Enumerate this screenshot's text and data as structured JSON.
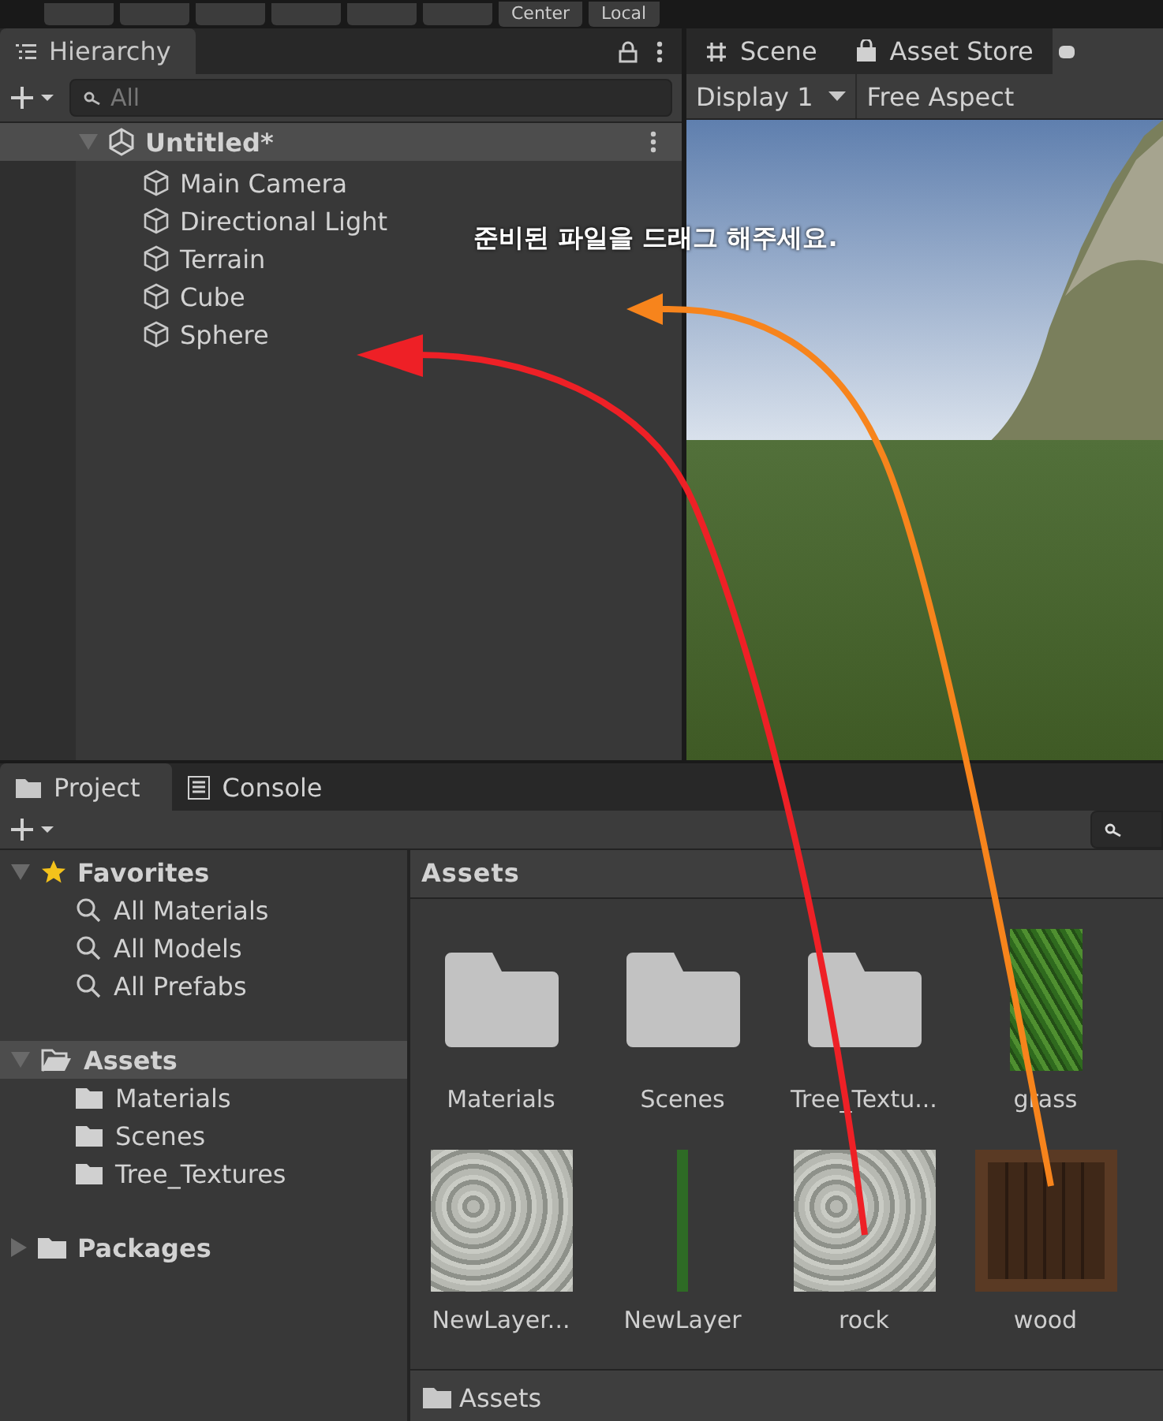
{
  "toolbar": {
    "buttons": [
      {
        "label": "Center"
      },
      {
        "label": "Local"
      }
    ]
  },
  "hierarchy": {
    "tab": {
      "label": "Hierarchy",
      "selected": true
    },
    "search": {
      "placeholder": "All"
    },
    "scene": {
      "label": "Untitled*",
      "expanded": true,
      "children": [
        {
          "label": "Main Camera"
        },
        {
          "label": "Directional Light"
        },
        {
          "label": "Terrain"
        },
        {
          "label": "Cube"
        },
        {
          "label": "Sphere"
        }
      ]
    }
  },
  "view": {
    "tabs": [
      {
        "label": "Scene",
        "selected": false
      },
      {
        "label": "Asset Store",
        "selected": false
      }
    ],
    "display": "Display 1",
    "aspect": "Free Aspect"
  },
  "project": {
    "tabs": [
      {
        "label": "Project",
        "selected": true
      },
      {
        "label": "Console",
        "selected": false
      }
    ],
    "tree": [
      {
        "label": "Favorites",
        "kind": "favorites",
        "expanded": true,
        "selected": false,
        "children": [
          {
            "label": "All Materials"
          },
          {
            "label": "All Models"
          },
          {
            "label": "All Prefabs"
          }
        ]
      },
      {
        "label": "Assets",
        "kind": "folder",
        "expanded": true,
        "selected": true,
        "children": [
          {
            "label": "Materials"
          },
          {
            "label": "Scenes"
          },
          {
            "label": "Tree_Textures"
          }
        ]
      },
      {
        "label": "Packages",
        "kind": "folder",
        "expanded": false,
        "selected": false
      }
    ],
    "grid_title": "Assets",
    "assets": [
      {
        "label": "Materials",
        "kind": "folder"
      },
      {
        "label": "Scenes",
        "kind": "folder"
      },
      {
        "label": "Tree_Textu...",
        "kind": "folder"
      },
      {
        "label": "grass",
        "kind": "grass"
      },
      {
        "label": "NewLayer...",
        "kind": "rock"
      },
      {
        "label": "NewLayer",
        "kind": "strip"
      },
      {
        "label": "rock",
        "kind": "rock"
      },
      {
        "label": "wood",
        "kind": "wood"
      }
    ],
    "path": "Assets"
  },
  "annotation": {
    "text": "준비된 파일을 드래그 해주세요."
  }
}
